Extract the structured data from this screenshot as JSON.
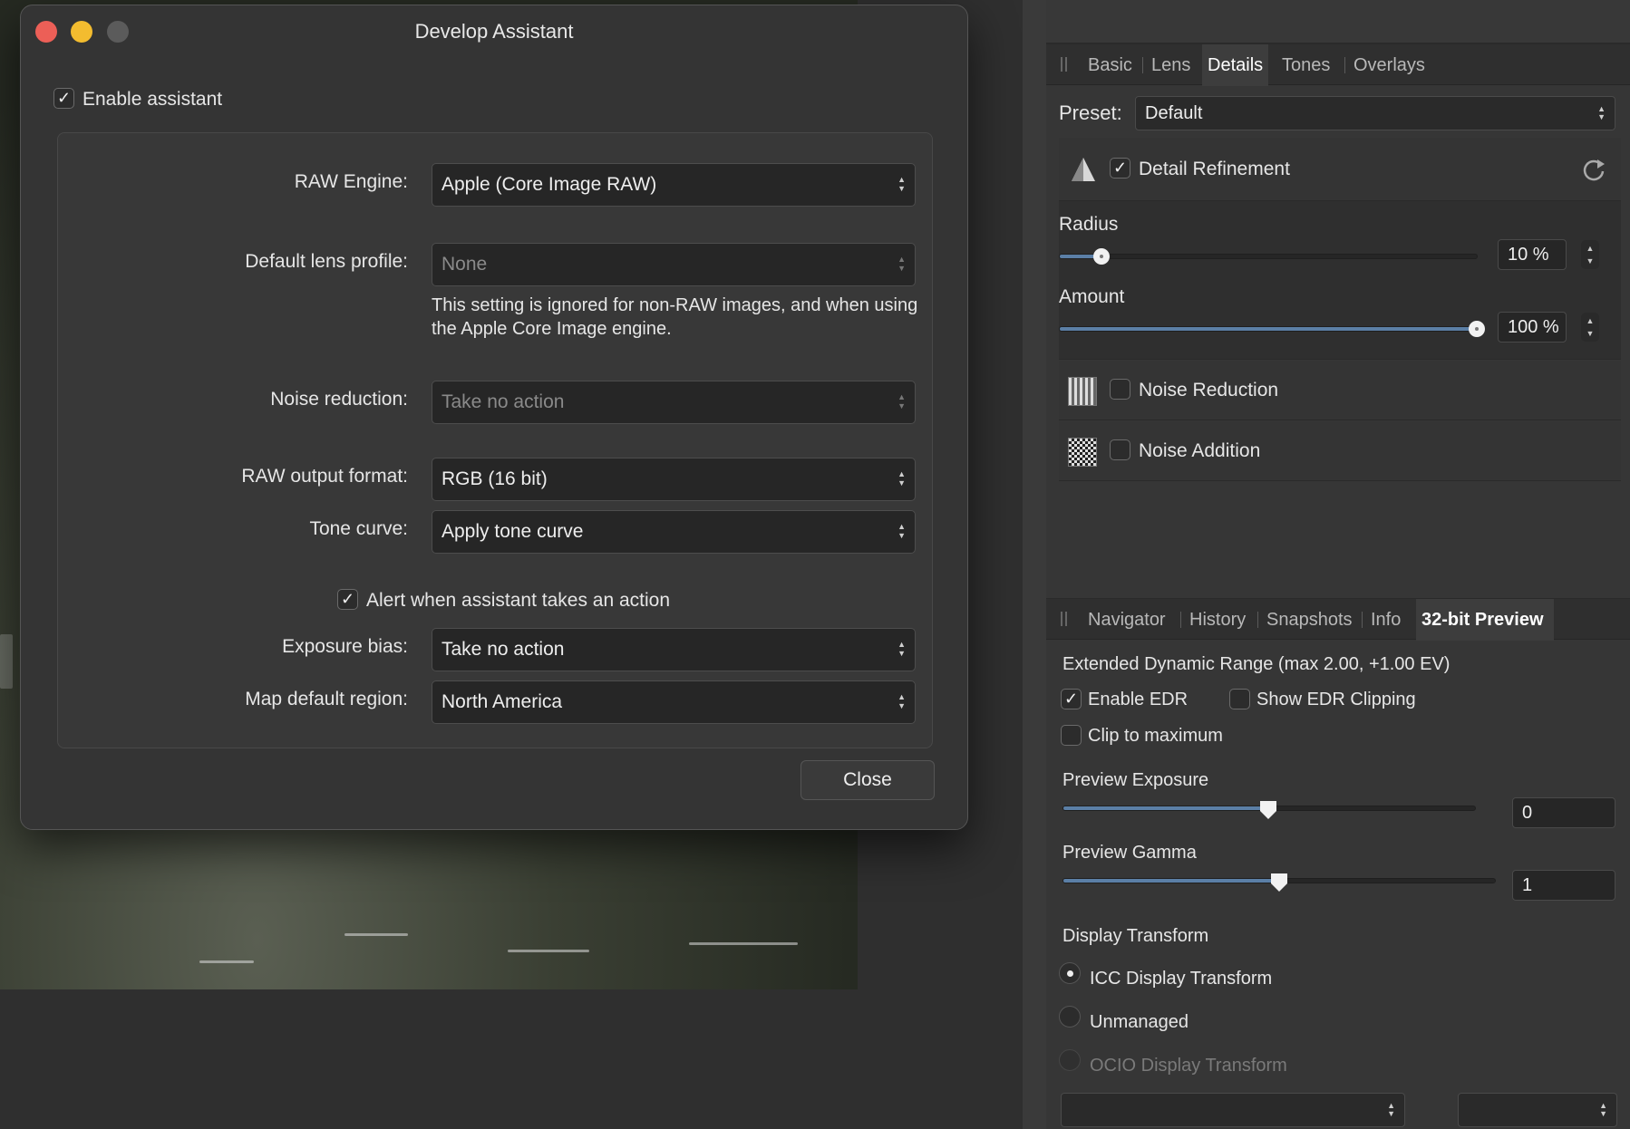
{
  "dialog": {
    "title": "Develop Assistant",
    "enable_label": "Enable assistant",
    "raw_engine_label": "RAW Engine:",
    "raw_engine_value": "Apple (Core Image RAW)",
    "lens_profile_label": "Default lens profile:",
    "lens_profile_value": "None",
    "lens_note": "This setting is ignored for non-RAW images, and when using the Apple Core Image engine.",
    "noise_label": "Noise reduction:",
    "noise_value": "Take no action",
    "output_label": "RAW output format:",
    "output_value": "RGB (16 bit)",
    "tone_label": "Tone curve:",
    "tone_value": "Apply tone curve",
    "alert_label": "Alert when assistant takes an action",
    "exposure_label": "Exposure bias:",
    "exposure_value": "Take no action",
    "region_label": "Map default region:",
    "region_value": "North America",
    "close_label": "Close",
    "checkmark": "✓"
  },
  "details_panel": {
    "tabs": [
      "Basic",
      "Lens",
      "Details",
      "Tones",
      "Overlays"
    ],
    "active_tab": "Details",
    "preset_label": "Preset:",
    "preset_value": "Default",
    "detail_refinement": "Detail Refinement",
    "radius_label": "Radius",
    "radius_value": "10 %",
    "radius_fraction": 0.1,
    "amount_label": "Amount",
    "amount_value": "100 %",
    "amount_fraction": 1.0,
    "noise_reduction": "Noise Reduction",
    "noise_addition": "Noise Addition"
  },
  "preview_panel": {
    "tabs": [
      "Navigator",
      "History",
      "Snapshots",
      "Info",
      "32-bit Preview"
    ],
    "active_tab": "32-bit Preview",
    "edr_text": "Extended Dynamic Range (max 2.00, +1.00 EV)",
    "enable_edr": "Enable EDR",
    "show_clipping": "Show EDR Clipping",
    "clip_max": "Clip to maximum",
    "exposure_label": "Preview Exposure",
    "exposure_value": "0",
    "gamma_label": "Preview Gamma",
    "gamma_value": "1",
    "display_transform_label": "Display Transform",
    "icc": "ICC Display Transform",
    "unmanaged": "Unmanaged",
    "ocio": "OCIO Display Transform"
  },
  "colors": {
    "close": "#ec5f57",
    "minimize": "#f3bc2f",
    "zoom": "#5b5b5b",
    "slider_fill": "#5b7fa6"
  }
}
